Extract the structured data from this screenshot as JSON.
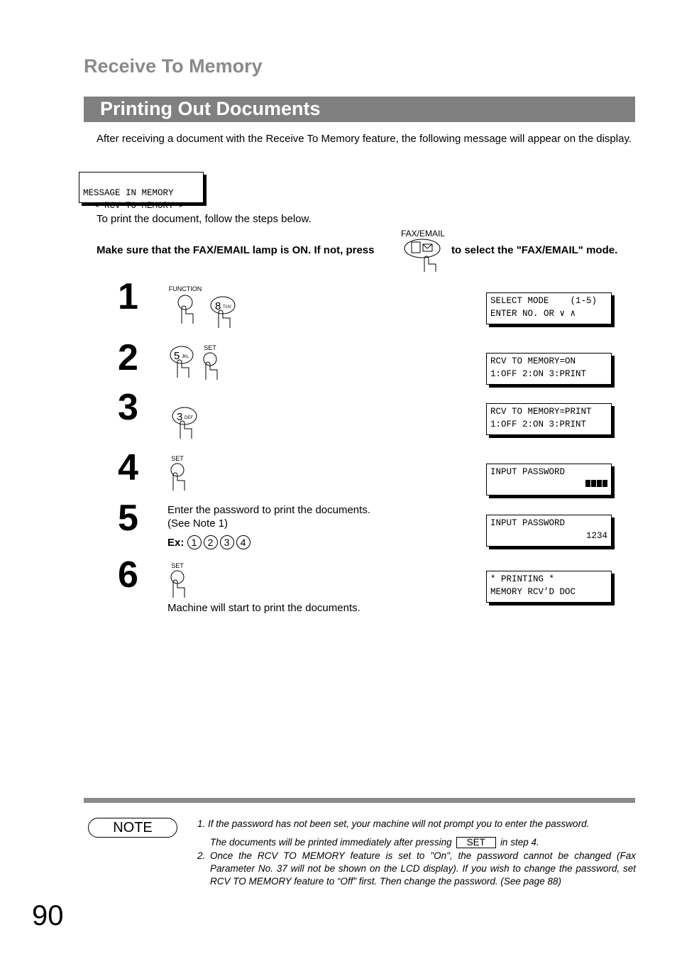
{
  "header": {
    "section": "Receive To Memory",
    "title": "Printing Out Documents"
  },
  "intro": "After receiving a document with the Receive To Memory feature, the following message will appear on the display.",
  "initial_display": [
    "MESSAGE IN MEMORY",
    "  < RCV TO MEMORY >"
  ],
  "follow_text": "To print the document, follow the steps below.",
  "lamp": {
    "text_before": "Make sure that the FAX/EMAIL lamp is ON.  If not, press",
    "key_label": "FAX/EMAIL",
    "text_after": "to select the \"FAX/EMAIL\" mode."
  },
  "steps": [
    {
      "number": "1",
      "keys": [
        {
          "label": "FUNCTION"
        },
        {
          "digit": "8",
          "letters": "TUV"
        }
      ],
      "display": [
        "SELECT MODE    (1-5)",
        "ENTER NO. OR ∨ ∧"
      ]
    },
    {
      "number": "2",
      "keys": [
        {
          "digit": "5",
          "letters": "JKL"
        },
        {
          "label": "SET"
        }
      ],
      "display": [
        "RCV TO MEMORY=ON",
        "1:OFF 2:ON 3:PRINT"
      ]
    },
    {
      "number": "3",
      "keys": [
        {
          "digit": "3",
          "letters": "DEF"
        }
      ],
      "display": [
        "RCV TO MEMORY=PRINT",
        "1:OFF 2:ON 3:PRINT"
      ]
    },
    {
      "number": "4",
      "keys": [
        {
          "label": "SET"
        }
      ],
      "display": [
        "INPUT PASSWORD",
        ""
      ],
      "password_mask_blocks": 4
    },
    {
      "number": "5",
      "text": "Enter the password to print the documents.",
      "text2": "(See Note 1)",
      "ex_label": "Ex:",
      "ex_keys": [
        "1",
        "2",
        "3",
        "4"
      ],
      "display": [
        "INPUT PASSWORD",
        "1234"
      ]
    },
    {
      "number": "6",
      "keys": [
        {
          "label": "SET"
        }
      ],
      "text": "Machine will start to print the documents.",
      "display": [
        "* PRINTING *",
        "MEMORY RCV’D DOC"
      ]
    }
  ],
  "note": {
    "label": "NOTE",
    "items": [
      {
        "n": "1.",
        "text": "If the password has not been set, your machine will not prompt you to enter the password.",
        "sub_before": "The documents will be printed immediately after pressing",
        "sub_key": "SET",
        "sub_after": "in step 4."
      },
      {
        "n": "2.",
        "text": "Once the RCV TO MEMORY feature is set to \"On\",  the password cannot be changed (Fax Parameter No.  37 will not be shown on the LCD display).  If you wish to change the password, set RCV TO MEMORY feature to “Off” first.  Then change the password.  (See page 88)"
      }
    ]
  },
  "page_number": "90",
  "colors": {
    "heading_gray": "#8a8a8a",
    "bar_gray": "#808080"
  }
}
